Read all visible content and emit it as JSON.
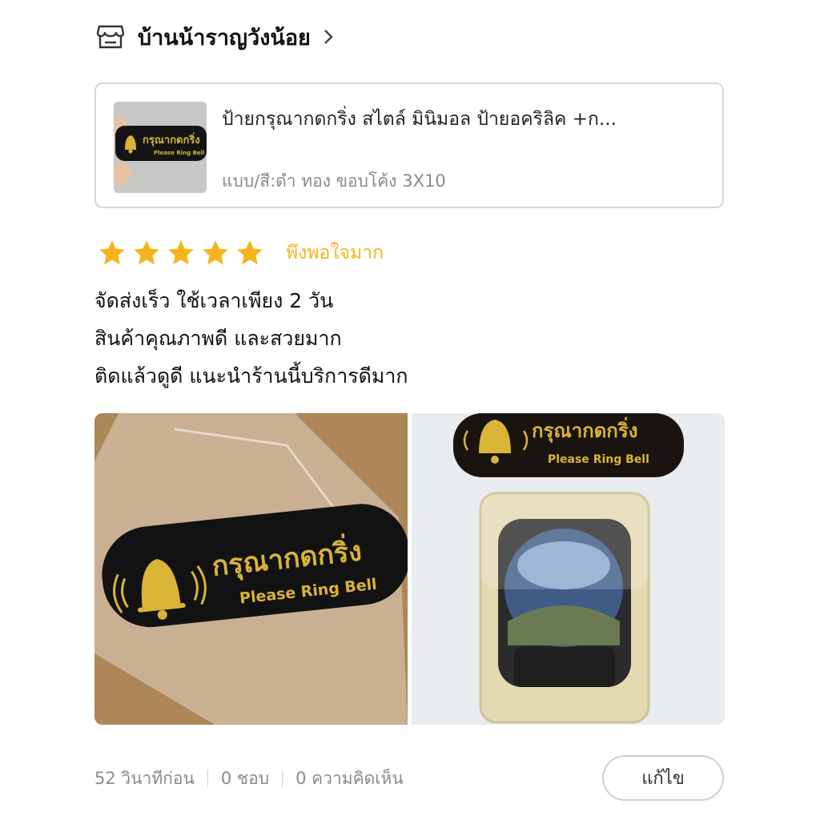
{
  "shop": {
    "name": "บ้านน้าราญวังน้อย",
    "icon": "store-icon"
  },
  "product": {
    "title": "ป้ายกรุณากดกริ่ง สไตล์ มินิมอล ป้ายอคริลิค +ก...",
    "variant": "แบบ/สี:ดำ ทอง ขอบโค้ง 3X10",
    "thumb_sign_thai": "กรุณากดกริ่ง",
    "thumb_sign_en": "Please Ring Bell"
  },
  "rating": {
    "stars": 5,
    "max": 5,
    "label": "พึงพอใจมาก",
    "star_color": "#f5b41b"
  },
  "review": {
    "lines": [
      "จัดส่งเร็ว ใช้เวลาเพียง 2 วัน",
      "สินค้าคุณภาพดี และสวยมาก",
      "ติดแล้วดูดี แนะนำร้านนี้บริการดีมาก"
    ]
  },
  "photos": [
    {
      "sign_thai": "กรุณากดกริ่ง",
      "sign_en": "Please Ring Bell"
    },
    {
      "sign_thai": "กรุณากดกริ่ง",
      "sign_en": "Please Ring Bell"
    }
  ],
  "footer": {
    "time": "52 วินาทีก่อน",
    "likes": "0 ชอบ",
    "comments": "0 ความคิดเห็น",
    "edit_label": "แก้ไข"
  },
  "colors": {
    "sign_black": "#111111",
    "sign_gold": "#d9b437",
    "text_muted": "#8a8a8a"
  }
}
